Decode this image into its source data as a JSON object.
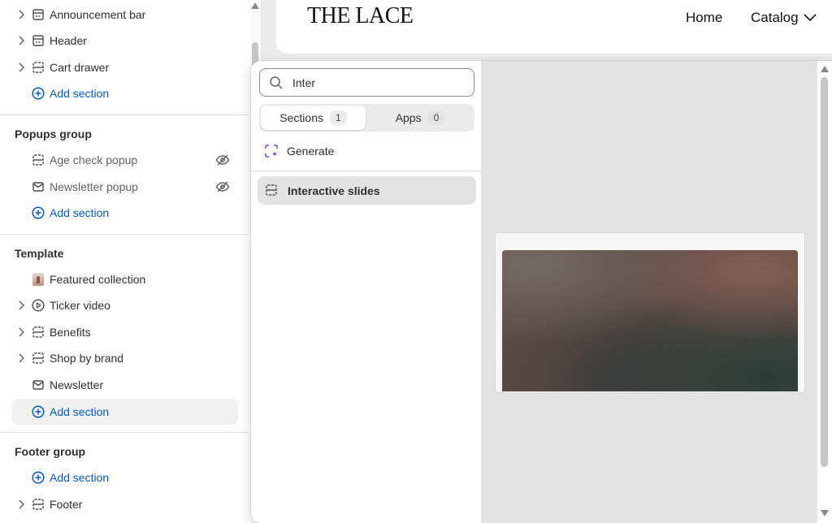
{
  "sidebar": {
    "header_items": [
      {
        "label": "Announcement bar",
        "icon": "section-icon"
      },
      {
        "label": "Header",
        "icon": "section-icon"
      },
      {
        "label": "Cart drawer",
        "icon": "section-icon"
      }
    ],
    "header_add": "Add section",
    "popups": {
      "title": "Popups group",
      "items": [
        {
          "label": "Age check popup",
          "icon": "section-icon"
        },
        {
          "label": "Newsletter popup",
          "icon": "mail-icon"
        }
      ],
      "add": "Add section"
    },
    "template": {
      "title": "Template",
      "items": [
        {
          "label": "Featured collection",
          "icon": "image-thumb"
        },
        {
          "label": "Ticker video",
          "icon": "play-icon"
        },
        {
          "label": "Benefits",
          "icon": "section-icon"
        },
        {
          "label": "Shop by brand",
          "icon": "section-icon"
        },
        {
          "label": "Newsletter",
          "icon": "mail-icon"
        }
      ],
      "add": "Add section"
    },
    "footer": {
      "title": "Footer group",
      "add": "Add section",
      "items": [
        {
          "label": "Footer",
          "icon": "section-icon"
        }
      ]
    }
  },
  "store": {
    "logo": "THE LACE",
    "nav": [
      "Home",
      "Catalog"
    ]
  },
  "picker": {
    "search_value": "Inter",
    "tabs": [
      {
        "label": "Sections",
        "count": "1"
      },
      {
        "label": "Apps",
        "count": "0"
      }
    ],
    "generate_label": "Generate",
    "results": [
      {
        "label": "Interactive slides"
      }
    ]
  },
  "colors": {
    "link": "#005bd3",
    "accent_generate": "#7c3aed"
  }
}
